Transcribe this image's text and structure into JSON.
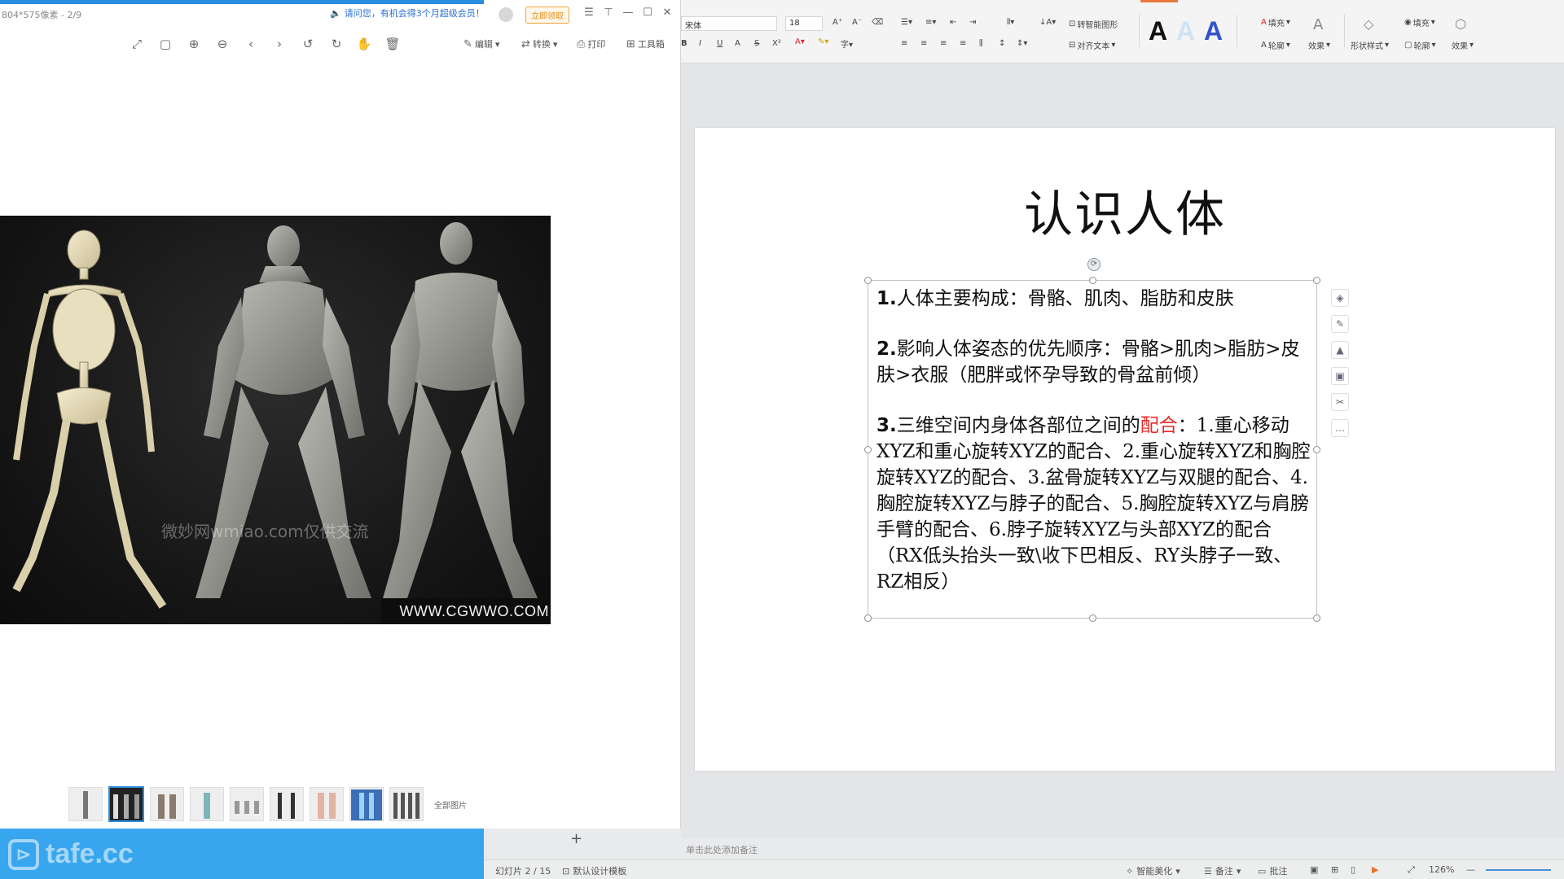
{
  "viewer": {
    "title": "804*575像素 - 2/9",
    "ad_text": "请问您，有机会得3个月超级会员！",
    "vip_label": "立即领取",
    "toolbar": {
      "edit": "编辑",
      "convert": "转换",
      "print": "打印",
      "toolbox": "工具箱"
    },
    "image_watermark": "微妙网wmiao.com仅供交流",
    "image_site": "WWW.CGWWO.COM",
    "thumbnails": [
      "thumb-1",
      "thumb-2",
      "thumb-3",
      "thumb-4",
      "thumb-5",
      "thumb-6",
      "thumb-7",
      "thumb-8",
      "thumb-9"
    ],
    "thumbs_label": "全部图片"
  },
  "brand": {
    "name": "tafe.cc"
  },
  "ribbon": {
    "font_name": "宋体",
    "font_size": "18",
    "smartgraphic": "转智能图形",
    "align_text": "对齐文本",
    "fill": "填充",
    "outline": "轮廓",
    "effect": "效果",
    "shape_style": "形状样式",
    "fill2": "填充",
    "outline2": "轮廓",
    "effect2": "效果"
  },
  "slide": {
    "title": "认识人体",
    "p1": {
      "num": "1.",
      "text": "人体主要构成：骨骼、肌肉、脂肪和皮肤"
    },
    "p2": {
      "num": "2.",
      "text": "影响人体姿态的优先顺序：骨骼>肌肉>脂肪>皮肤>衣服（肥胖或怀孕导致的骨盆前倾）"
    },
    "p3": {
      "num": "3.",
      "lead": "三维空间内身体各部位之间的",
      "highlight": "配合",
      "rest": "：1.重心移动XYZ和重心旋转XYZ的配合、2.重心旋转XYZ和胸腔旋转XYZ的配合、3.盆骨旋转XYZ与双腿的配合、4.胸腔旋转XYZ与脖子的配合、5.胸腔旋转XYZ与肩膀手臂的配合、6.脖子旋转XYZ与头部XYZ的配合（RX低头抬头一致\\收下巴相反、RY头脖子一致、RZ相反）"
    }
  },
  "notes_placeholder": "单击此处添加备注",
  "status": {
    "slide_counter": "幻灯片 2 / 15",
    "theme": "默认设计模板",
    "beautify": "智能美化",
    "notes": "备注",
    "comment": "批注",
    "zoom": "126%"
  },
  "colors": {
    "accent_blue": "#2a8de0",
    "tafe_blue": "#38a6ef",
    "highlight_red": "#e52a2a"
  }
}
